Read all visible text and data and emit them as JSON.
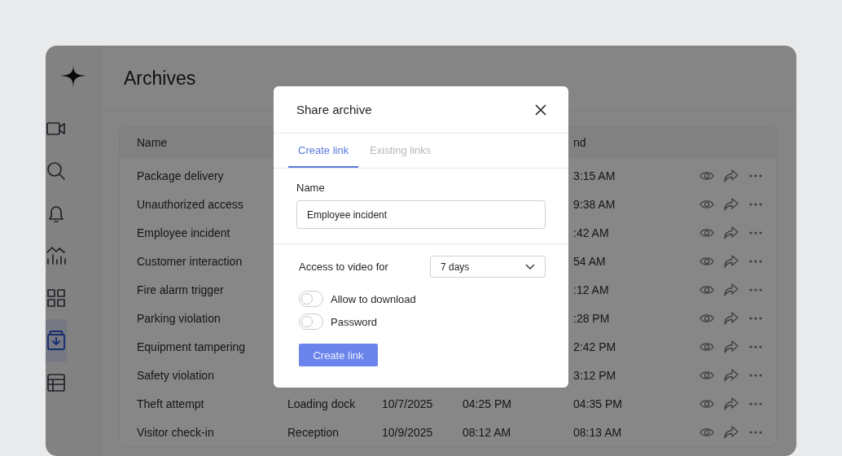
{
  "sidebar": {
    "items": [
      {
        "selected": false
      },
      {
        "selected": false
      },
      {
        "selected": false
      },
      {
        "selected": false
      },
      {
        "selected": false
      },
      {
        "selected": true
      },
      {
        "selected": false
      }
    ]
  },
  "page": {
    "title": "Archives"
  },
  "table": {
    "columns": {
      "name": "Name",
      "end": "nd"
    },
    "rows": [
      {
        "name": "Package delivery",
        "end": "3:15 AM"
      },
      {
        "name": "Unauthorized access",
        "end": "9:38 AM"
      },
      {
        "name": "Employee incident",
        "end": ":42 AM"
      },
      {
        "name": "Customer interaction",
        "end": "54 AM"
      },
      {
        "name": "Fire alarm trigger",
        "end": ":12 AM"
      },
      {
        "name": "Parking violation",
        "end": ":28 PM"
      },
      {
        "name": "Equipment tampering",
        "end": "2:42 PM"
      },
      {
        "name": "Safety violation",
        "end": "3:12 PM"
      },
      {
        "name": "Theft attempt",
        "location": "Loading dock",
        "date": "10/7/2025",
        "start": "04:25 PM",
        "end": "04:35 PM"
      },
      {
        "name": "Visitor check-in",
        "location": "Reception",
        "date": "10/9/2025",
        "start": "08:12 AM",
        "end": "08:13 AM"
      }
    ]
  },
  "dialog": {
    "title": "Share archive",
    "tabs": [
      {
        "label": "Create link",
        "selected": true
      },
      {
        "label": "Existing links",
        "selected": false
      }
    ],
    "name_label": "Name",
    "name_value": "Employee incident",
    "access_label": "Access to video for",
    "access_value": "7 days",
    "toggles": [
      {
        "label": "Allow to download",
        "on": false
      },
      {
        "label": "Password",
        "on": false
      }
    ],
    "button": "Create link"
  }
}
